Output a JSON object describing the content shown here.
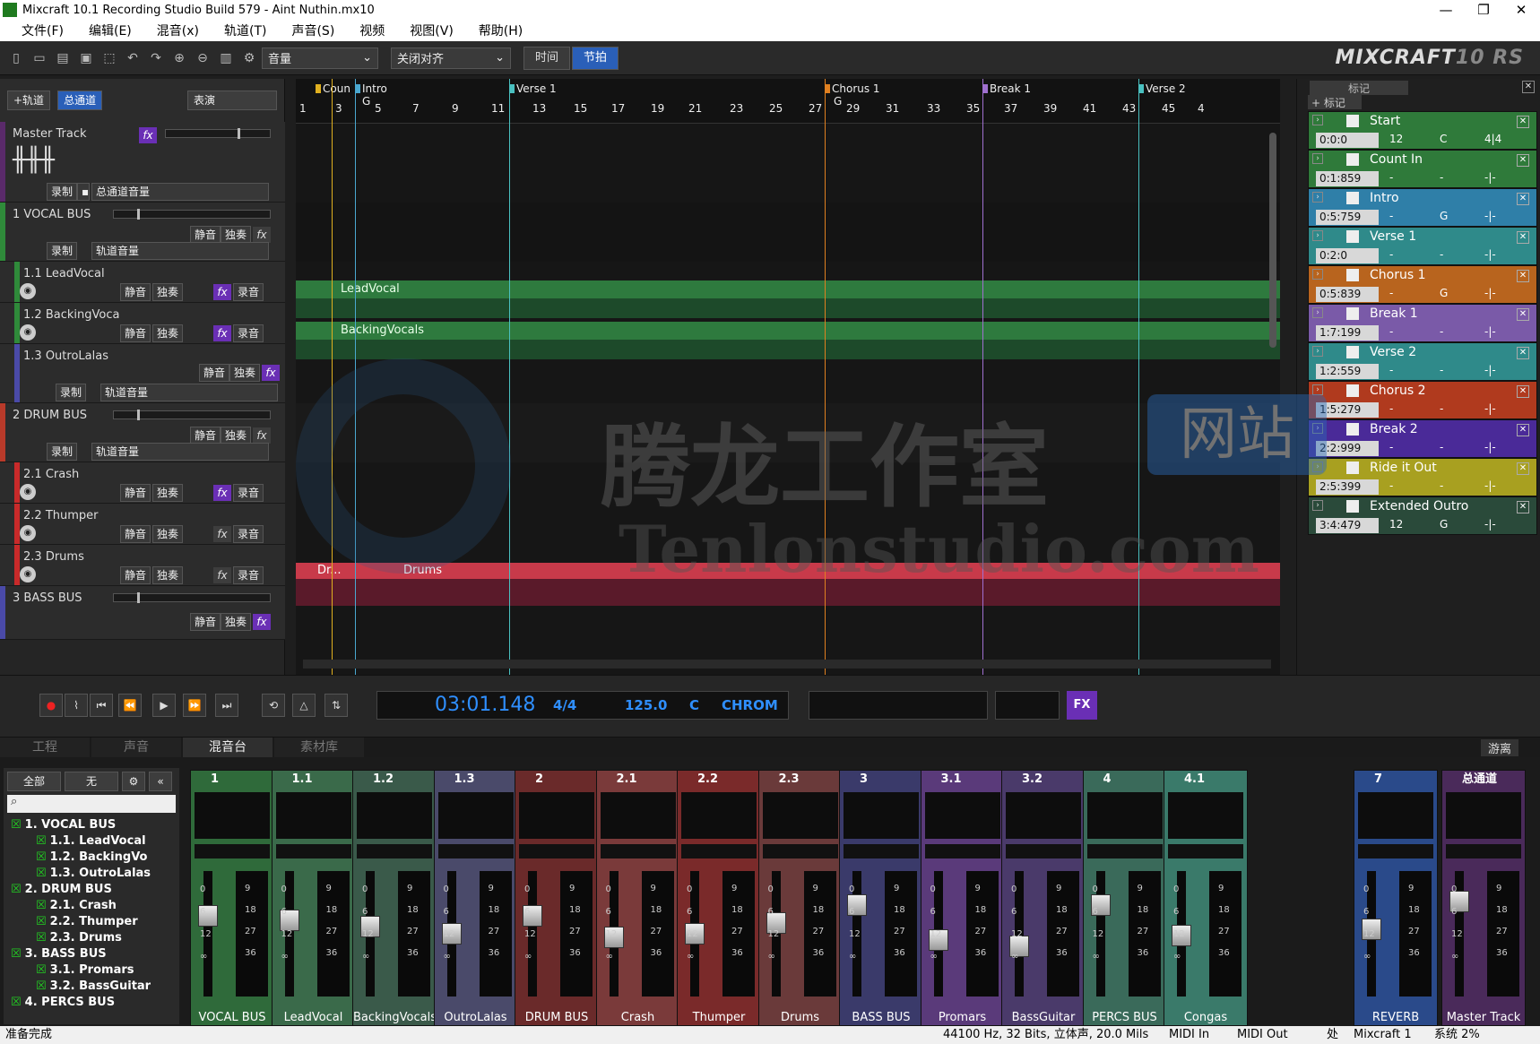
{
  "app": {
    "title": "Mixcraft 10.1 Recording Studio Build 579 - Aint Nuthin.mx10",
    "brand": "MIXCRAFT",
    "brand_version": "10",
    "brand_edition": "RS"
  },
  "window": {
    "min": "—",
    "max": "❐",
    "close": "✕"
  },
  "menu": [
    "文件(F)",
    "编辑(E)",
    "混音(x)",
    "轨道(T)",
    "声音(S)",
    "视频",
    "视图(V)",
    "帮助(H)"
  ],
  "toolbar": {
    "volume_select": "音量",
    "snap_select": "关闭对齐",
    "time_btn": "时间",
    "beat_btn": "节拍"
  },
  "trackpanel": {
    "add_track": "+轨道",
    "master_tab": "总通道",
    "perform_tab": "表演"
  },
  "tracks": {
    "master": {
      "name": "Master Track",
      "rec": "录制",
      "select": "总通道音量"
    },
    "vocal_bus": {
      "name": "1 VOCAL BUS",
      "mute": "静音",
      "solo": "独奏",
      "rec": "录制",
      "select": "轨道音量"
    },
    "lead": {
      "num": "1.1",
      "name": "LeadVocal",
      "mute": "静音",
      "solo": "独奏",
      "arm": "录音"
    },
    "backing": {
      "num": "1.2",
      "name": "BackingVoca",
      "mute": "静音",
      "solo": "独奏",
      "arm": "录音"
    },
    "outro": {
      "num": "1.3",
      "name": "OutroLalas",
      "mute": "静音",
      "solo": "独奏",
      "rec": "录制",
      "select": "轨道音量"
    },
    "drum_bus": {
      "name": "2 DRUM BUS",
      "mute": "静音",
      "solo": "独奏",
      "rec": "录制",
      "select": "轨道音量"
    },
    "crash": {
      "num": "2.1",
      "name": "Crash",
      "mute": "静音",
      "solo": "独奏",
      "arm": "录音"
    },
    "thumper": {
      "num": "2.2",
      "name": "Thumper",
      "mute": "静音",
      "solo": "独奏",
      "arm": "录音"
    },
    "drums": {
      "num": "2.3",
      "name": "Drums",
      "mute": "静音",
      "solo": "独奏",
      "arm": "录音"
    },
    "bass_bus": {
      "name": "3 BASS BUS",
      "mute": "静音",
      "solo": "独奏"
    }
  },
  "ruler": {
    "ticks": [
      "1",
      "3",
      "5",
      "7",
      "9",
      "11",
      "13",
      "15",
      "17",
      "19",
      "21",
      "23",
      "25",
      "27",
      "29",
      "31",
      "33",
      "35",
      "37",
      "39",
      "41",
      "43",
      "45",
      "4"
    ],
    "markers": [
      {
        "label": "Coun",
        "color": "#e0b020"
      },
      {
        "label": "Intro",
        "color": "#4aa8d0"
      },
      {
        "label": "Verse 1",
        "color": "#4ac0c0"
      },
      {
        "label": "Chorus 1",
        "color": "#e08020"
      },
      {
        "label": "Break 1",
        "color": "#a070d0"
      },
      {
        "label": "Verse 2",
        "color": "#4ac0c0"
      }
    ],
    "g_labels": [
      "G",
      "G"
    ]
  },
  "clips": {
    "lead": "LeadVocal",
    "backing": "BackingVocals",
    "drums_short": "Dr...",
    "drums": "Drums"
  },
  "markerpanel": {
    "tab": "标记",
    "add": "+ 标记",
    "items": [
      {
        "name": "Start",
        "time": "0:0:0",
        "tempo": "12",
        "key": "C",
        "sig": "4|4",
        "color": "#2f7a3a"
      },
      {
        "name": "Count In",
        "time": "0:1:859",
        "tempo": "-",
        "key": "-",
        "sig": "-|-",
        "color": "#2f7a3a"
      },
      {
        "name": "Intro",
        "time": "0:5:759",
        "tempo": "-",
        "key": "G",
        "sig": "-|-",
        "color": "#2f7fa8"
      },
      {
        "name": "Verse 1",
        "time": "0:2:0",
        "tempo": "-",
        "key": "-",
        "sig": "-|-",
        "color": "#2f8a8a"
      },
      {
        "name": "Chorus 1",
        "time": "0:5:839",
        "tempo": "-",
        "key": "G",
        "sig": "-|-",
        "color": "#b8641e"
      },
      {
        "name": "Break 1",
        "time": "1:7:199",
        "tempo": "-",
        "key": "-",
        "sig": "-|-",
        "color": "#7a5aa8"
      },
      {
        "name": "Verse 2",
        "time": "1:2:559",
        "tempo": "-",
        "key": "-",
        "sig": "-|-",
        "color": "#2f8a8a"
      },
      {
        "name": "Chorus 2",
        "time": "1:5:279",
        "tempo": "-",
        "key": "-",
        "sig": "-|-",
        "color": "#b03a1e"
      },
      {
        "name": "Break 2",
        "time": "2:2:999",
        "tempo": "-",
        "key": "-",
        "sig": "-|-",
        "color": "#4a2a98"
      },
      {
        "name": "Ride it Out",
        "time": "2:5:399",
        "tempo": "-",
        "key": "-",
        "sig": "-|-",
        "color": "#a8a020"
      },
      {
        "name": "Extended Outro",
        "time": "3:4:479",
        "tempo": "12",
        "key": "G",
        "sig": "-|-",
        "color": "#2a4a3a"
      }
    ]
  },
  "transport": {
    "time": "03:01.148",
    "sig": "4/4",
    "tempo": "125.0",
    "key": "C",
    "scale": "CHROM",
    "fx": "FX"
  },
  "tabs": [
    "工程",
    "声音",
    "混音台",
    "素材库"
  ],
  "detach": "游离",
  "navtree": {
    "all": "全部",
    "none": "无",
    "rows": [
      "1. VOCAL BUS",
      "1.1. LeadVocal",
      "1.2. BackingVo",
      "1.3. OutroLalas",
      "2. DRUM BUS",
      "2.1. Crash",
      "2.2. Thumper",
      "2.3. Drums",
      "3. BASS BUS",
      "3.1. Promars",
      "3.2. BassGuitar",
      "4. PERCS BUS"
    ]
  },
  "mixer": {
    "scale_left": [
      "0",
      "6",
      "12",
      "∞"
    ],
    "scale_right": [
      "9",
      "18",
      "27",
      "36"
    ],
    "strips": [
      {
        "num": "1",
        "name": "VOCAL BUS",
        "color": "#2f6a3a"
      },
      {
        "num": "1.1",
        "name": "LeadVocal",
        "color": "#3a6a4a"
      },
      {
        "num": "1.2",
        "name": "BackingVocals",
        "color": "#3a5a4a"
      },
      {
        "num": "1.3",
        "name": "OutroLalas",
        "color": "#4a4a6a"
      },
      {
        "num": "2",
        "name": "DRUM BUS",
        "color": "#6a2a2a"
      },
      {
        "num": "2.1",
        "name": "Crash",
        "color": "#7a3a3a"
      },
      {
        "num": "2.2",
        "name": "Thumper",
        "color": "#7a2a2a"
      },
      {
        "num": "2.3",
        "name": "Drums",
        "color": "#6a3a3a"
      },
      {
        "num": "3",
        "name": "BASS BUS",
        "color": "#3a3a6a"
      },
      {
        "num": "3.1",
        "name": "Promars",
        "color": "#5a3a7a"
      },
      {
        "num": "3.2",
        "name": "BassGuitar",
        "color": "#4a3a6a"
      },
      {
        "num": "4",
        "name": "PERCS BUS",
        "color": "#3a6a5a"
      },
      {
        "num": "4.1",
        "name": "Congas",
        "color": "#3a7a6a"
      },
      {
        "num": "7",
        "name": "REVERB",
        "color": "#2a4a8a"
      },
      {
        "num": "总通道",
        "name": "Master Track",
        "color": "#4a2a5a"
      }
    ]
  },
  "status": {
    "ready": "准备完成",
    "format": "44100 Hz, 32 Bits, 立体声, 20.0 Mils",
    "midi_in": "MIDI In",
    "midi_out": "MIDI Out",
    "wait": "处",
    "ver": "Mixcraft 1",
    "sys": "系统 2%"
  },
  "watermark": {
    "cn": "腾龙工作室",
    "badge": "网站",
    "url": "Tenlonstudio.com"
  }
}
